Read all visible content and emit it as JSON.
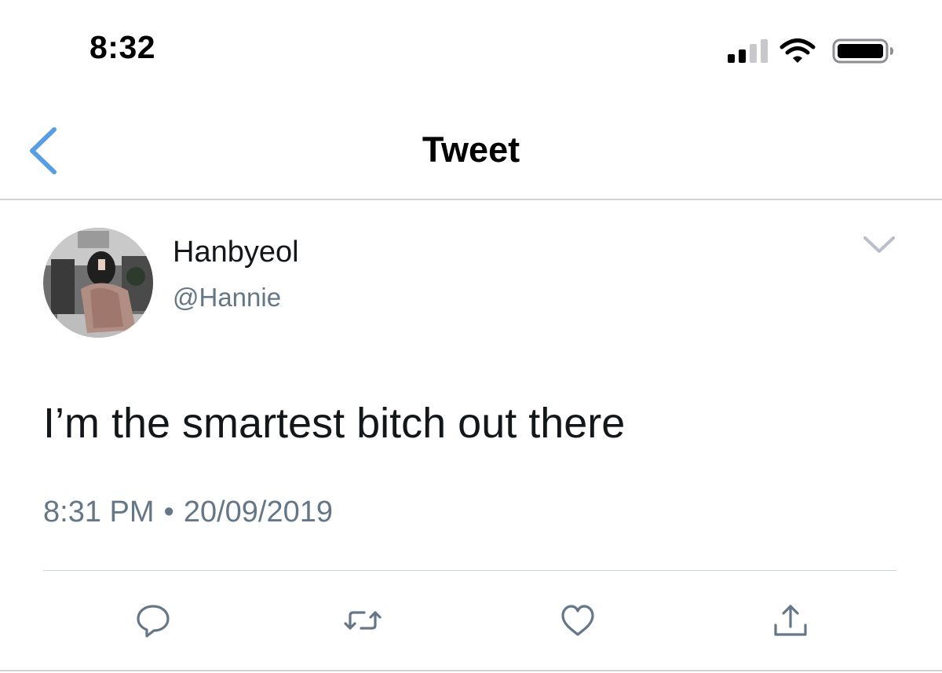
{
  "status_bar": {
    "time": "8:32"
  },
  "nav": {
    "title": "Tweet"
  },
  "tweet": {
    "author_name": "Hanbyeol",
    "author_handle": "@Hannie",
    "text": "I’m the smartest bitch out there",
    "time": "8:31 PM",
    "separator": "•",
    "date": "20/09/2019"
  },
  "icons": {
    "back": "chevron-left-icon",
    "more": "chevron-down-icon",
    "reply": "reply-icon",
    "retweet": "retweet-icon",
    "like": "heart-icon",
    "share": "share-icon"
  },
  "colors": {
    "accent": "#5a9ee2",
    "text_primary": "#14171a",
    "text_secondary": "#657786",
    "divider": "#ccd6dd"
  }
}
